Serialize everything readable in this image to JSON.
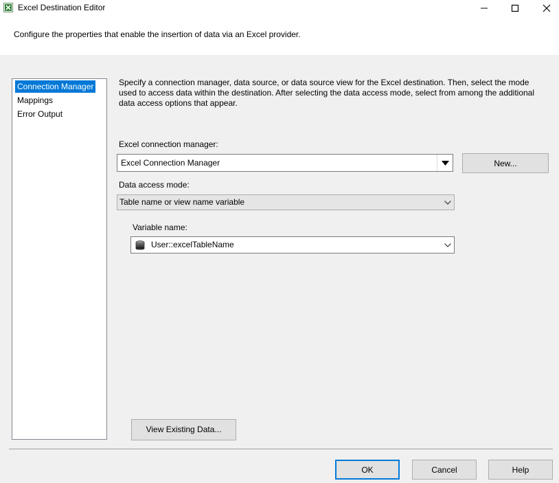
{
  "window": {
    "title": "Excel Destination Editor",
    "controls": {
      "minimize": "–",
      "maximize": "☐",
      "close": "✕"
    }
  },
  "header": {
    "description": "Configure the properties that enable the insertion of data via an Excel provider."
  },
  "sidebar": {
    "items": [
      {
        "label": "Connection Manager",
        "selected": true
      },
      {
        "label": "Mappings",
        "selected": false
      },
      {
        "label": "Error Output",
        "selected": false
      }
    ]
  },
  "main": {
    "description": "Specify a connection manager, data source, or data source view for the Excel destination. Then, select the mode used to access data within the destination. After selecting the data access mode, select from among the additional data access options that appear.",
    "connection_manager_label": "Excel connection manager:",
    "connection_manager_value": "Excel Connection Manager",
    "new_button": "New...",
    "data_access_mode_label": "Data access mode:",
    "data_access_mode_value": "Table name or view name variable",
    "variable_name_label": "Variable name:",
    "variable_name_value": "User::excelTableName",
    "view_existing_data_button": "View Existing Data..."
  },
  "footer": {
    "ok": "OK",
    "cancel": "Cancel",
    "help": "Help"
  },
  "colors": {
    "accent": "#0078d7",
    "selection_text": "#ffffff"
  }
}
